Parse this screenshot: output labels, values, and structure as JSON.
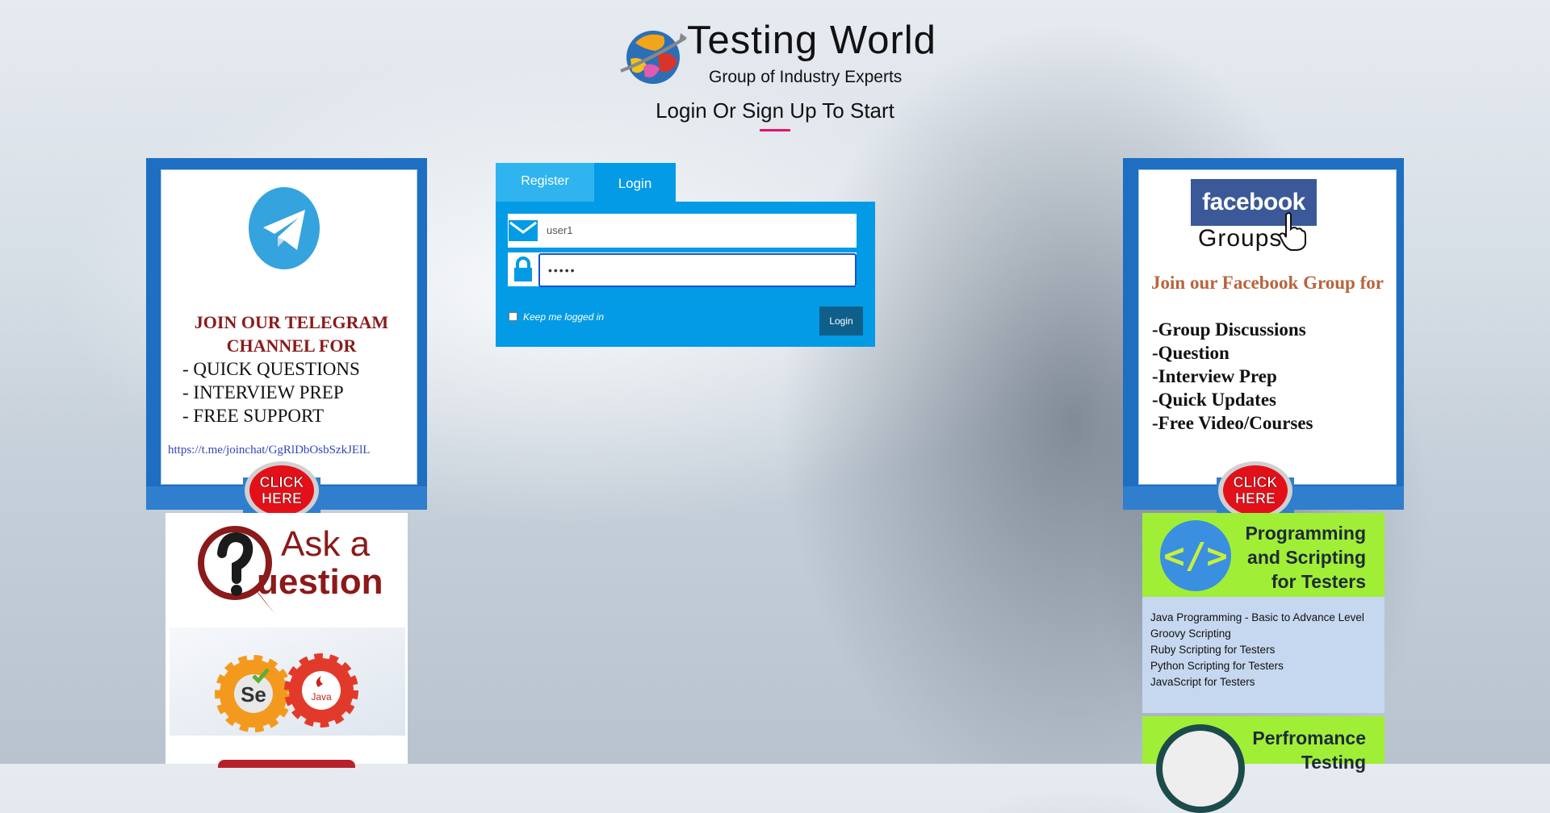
{
  "header": {
    "brand_title": "Testing World",
    "brand_subtitle": "Group of Industry Experts",
    "login_heading": "Login Or Sign Up To Start"
  },
  "telegram_card": {
    "heading": "JOIN OUR TELEGRAM CHANNEL  FOR",
    "items": [
      "- QUICK QUESTIONS",
      "- INTERVIEW PREP",
      "- FREE SUPPORT"
    ],
    "link": "https://t.me/joinchat/GgRlDbOsbSzkJElL",
    "click_label_1": "CLICK",
    "click_label_2": "HERE"
  },
  "ask_card": {
    "title_line1": "Ask a",
    "title_line2": "uestion",
    "badge_se": "Se",
    "badge_java": "Java"
  },
  "login_form": {
    "tab_register": "Register",
    "tab_login": "Login",
    "username_value": "user1",
    "password_value": "•••••",
    "keep_logged_in": "Keep me logged in",
    "login_button": "Login"
  },
  "facebook_card": {
    "logo_text": "facebook",
    "groups_text": "Groups",
    "heading": "Join our Facebook Group for",
    "items": [
      "-Group Discussions",
      "-Question",
      "-Interview Prep",
      "-Quick Updates",
      "-Free Video/Courses"
    ],
    "click_label_1": "CLICK",
    "click_label_2": "HERE"
  },
  "programming_card": {
    "title": "Programming and Scripting for Testers",
    "courses": [
      "Java Programming - Basic to Advance Level",
      "Groovy Scripting",
      "Ruby Scripting for Testers",
      "Python Scripting for Testers",
      "JavaScript for Testers"
    ]
  },
  "performance_card": {
    "title": "Perfromance Testing"
  },
  "colors": {
    "accent_blue": "#039be5",
    "tab_register": "#2fb4ef",
    "login_button": "#0e5f8a",
    "heading_underline": "#e8106d",
    "card_border": "#1e6fc1"
  },
  "icons": [
    "globe-logo-icon",
    "telegram-icon",
    "mail-icon",
    "lock-icon",
    "facebook-cursor-icon",
    "question-mark-icon",
    "selenium-gear-icon",
    "java-gear-icon",
    "code-icon"
  ]
}
